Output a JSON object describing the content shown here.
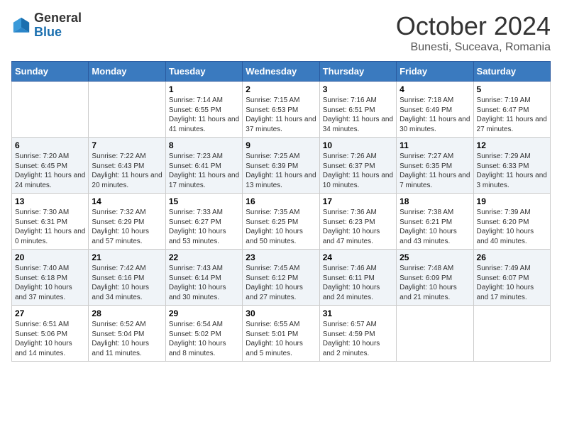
{
  "header": {
    "logo_general": "General",
    "logo_blue": "Blue",
    "month_title": "October 2024",
    "location": "Bunesti, Suceava, Romania"
  },
  "weekdays": [
    "Sunday",
    "Monday",
    "Tuesday",
    "Wednesday",
    "Thursday",
    "Friday",
    "Saturday"
  ],
  "weeks": [
    [
      {
        "day": "",
        "info": ""
      },
      {
        "day": "",
        "info": ""
      },
      {
        "day": "1",
        "info": "Sunrise: 7:14 AM\nSunset: 6:55 PM\nDaylight: 11 hours and 41 minutes."
      },
      {
        "day": "2",
        "info": "Sunrise: 7:15 AM\nSunset: 6:53 PM\nDaylight: 11 hours and 37 minutes."
      },
      {
        "day": "3",
        "info": "Sunrise: 7:16 AM\nSunset: 6:51 PM\nDaylight: 11 hours and 34 minutes."
      },
      {
        "day": "4",
        "info": "Sunrise: 7:18 AM\nSunset: 6:49 PM\nDaylight: 11 hours and 30 minutes."
      },
      {
        "day": "5",
        "info": "Sunrise: 7:19 AM\nSunset: 6:47 PM\nDaylight: 11 hours and 27 minutes."
      }
    ],
    [
      {
        "day": "6",
        "info": "Sunrise: 7:20 AM\nSunset: 6:45 PM\nDaylight: 11 hours and 24 minutes."
      },
      {
        "day": "7",
        "info": "Sunrise: 7:22 AM\nSunset: 6:43 PM\nDaylight: 11 hours and 20 minutes."
      },
      {
        "day": "8",
        "info": "Sunrise: 7:23 AM\nSunset: 6:41 PM\nDaylight: 11 hours and 17 minutes."
      },
      {
        "day": "9",
        "info": "Sunrise: 7:25 AM\nSunset: 6:39 PM\nDaylight: 11 hours and 13 minutes."
      },
      {
        "day": "10",
        "info": "Sunrise: 7:26 AM\nSunset: 6:37 PM\nDaylight: 11 hours and 10 minutes."
      },
      {
        "day": "11",
        "info": "Sunrise: 7:27 AM\nSunset: 6:35 PM\nDaylight: 11 hours and 7 minutes."
      },
      {
        "day": "12",
        "info": "Sunrise: 7:29 AM\nSunset: 6:33 PM\nDaylight: 11 hours and 3 minutes."
      }
    ],
    [
      {
        "day": "13",
        "info": "Sunrise: 7:30 AM\nSunset: 6:31 PM\nDaylight: 11 hours and 0 minutes."
      },
      {
        "day": "14",
        "info": "Sunrise: 7:32 AM\nSunset: 6:29 PM\nDaylight: 10 hours and 57 minutes."
      },
      {
        "day": "15",
        "info": "Sunrise: 7:33 AM\nSunset: 6:27 PM\nDaylight: 10 hours and 53 minutes."
      },
      {
        "day": "16",
        "info": "Sunrise: 7:35 AM\nSunset: 6:25 PM\nDaylight: 10 hours and 50 minutes."
      },
      {
        "day": "17",
        "info": "Sunrise: 7:36 AM\nSunset: 6:23 PM\nDaylight: 10 hours and 47 minutes."
      },
      {
        "day": "18",
        "info": "Sunrise: 7:38 AM\nSunset: 6:21 PM\nDaylight: 10 hours and 43 minutes."
      },
      {
        "day": "19",
        "info": "Sunrise: 7:39 AM\nSunset: 6:20 PM\nDaylight: 10 hours and 40 minutes."
      }
    ],
    [
      {
        "day": "20",
        "info": "Sunrise: 7:40 AM\nSunset: 6:18 PM\nDaylight: 10 hours and 37 minutes."
      },
      {
        "day": "21",
        "info": "Sunrise: 7:42 AM\nSunset: 6:16 PM\nDaylight: 10 hours and 34 minutes."
      },
      {
        "day": "22",
        "info": "Sunrise: 7:43 AM\nSunset: 6:14 PM\nDaylight: 10 hours and 30 minutes."
      },
      {
        "day": "23",
        "info": "Sunrise: 7:45 AM\nSunset: 6:12 PM\nDaylight: 10 hours and 27 minutes."
      },
      {
        "day": "24",
        "info": "Sunrise: 7:46 AM\nSunset: 6:11 PM\nDaylight: 10 hours and 24 minutes."
      },
      {
        "day": "25",
        "info": "Sunrise: 7:48 AM\nSunset: 6:09 PM\nDaylight: 10 hours and 21 minutes."
      },
      {
        "day": "26",
        "info": "Sunrise: 7:49 AM\nSunset: 6:07 PM\nDaylight: 10 hours and 17 minutes."
      }
    ],
    [
      {
        "day": "27",
        "info": "Sunrise: 6:51 AM\nSunset: 5:06 PM\nDaylight: 10 hours and 14 minutes."
      },
      {
        "day": "28",
        "info": "Sunrise: 6:52 AM\nSunset: 5:04 PM\nDaylight: 10 hours and 11 minutes."
      },
      {
        "day": "29",
        "info": "Sunrise: 6:54 AM\nSunset: 5:02 PM\nDaylight: 10 hours and 8 minutes."
      },
      {
        "day": "30",
        "info": "Sunrise: 6:55 AM\nSunset: 5:01 PM\nDaylight: 10 hours and 5 minutes."
      },
      {
        "day": "31",
        "info": "Sunrise: 6:57 AM\nSunset: 4:59 PM\nDaylight: 10 hours and 2 minutes."
      },
      {
        "day": "",
        "info": ""
      },
      {
        "day": "",
        "info": ""
      }
    ]
  ]
}
